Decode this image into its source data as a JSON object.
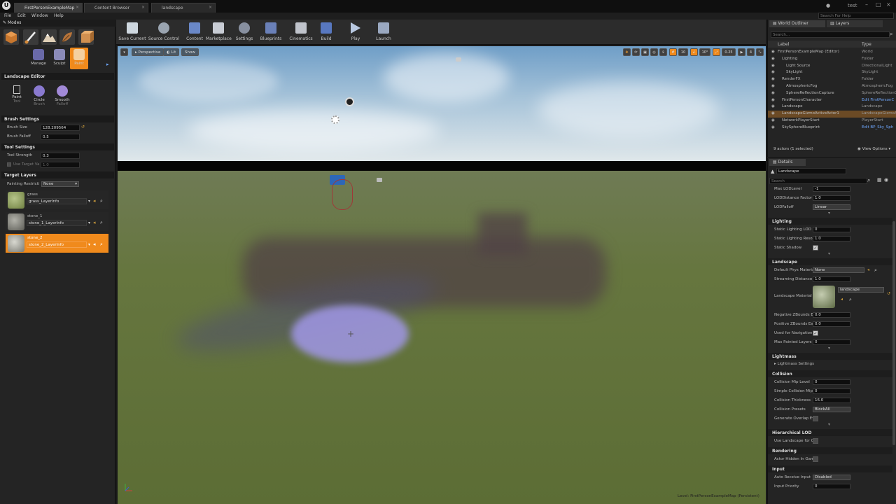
{
  "tabs": [
    "FirstPersonExampleMap",
    "Content Browser",
    "landscape"
  ],
  "menu": [
    "File",
    "Edit",
    "Window",
    "Help"
  ],
  "user": "test",
  "search_help_placeholder": "Search For Help",
  "modes": {
    "title": "Modes",
    "sub_buttons": [
      "Manage",
      "Sculpt",
      "Paint"
    ],
    "landscape_editor_title": "Landscape Editor",
    "tools": [
      {
        "label": "Paint",
        "sub": "Tool"
      },
      {
        "label": "Circle",
        "sub": "Brush"
      },
      {
        "label": "Smooth",
        "sub": "Falloff"
      }
    ],
    "brush_settings": {
      "title": "Brush Settings",
      "brush_size_label": "Brush Size",
      "brush_size_value": "128.209564",
      "brush_falloff_label": "Brush Falloff",
      "brush_falloff_value": "0.5"
    },
    "tool_settings": {
      "title": "Tool Settings",
      "tool_strength_label": "Tool Strength",
      "tool_strength_value": "0.3",
      "use_target_label": "Use Target Va",
      "use_target_value": "1.0"
    },
    "target_layers": {
      "title": "Target Layers",
      "painting_restrict_label": "Painting Restricti",
      "painting_restrict_value": "None",
      "layers": [
        {
          "name": "grass",
          "info": "grass_LayerInfo",
          "color": "#7d8c55"
        },
        {
          "name": "stone_1",
          "info": "stone_1_LayerInfo",
          "color": "#8a8a82"
        },
        {
          "name": "stone_2",
          "info": "stone_2_LayerInfo",
          "color": "#9a9a92"
        }
      ]
    }
  },
  "toolbar": [
    "Save Current",
    "Source Control",
    "Content",
    "Marketplace",
    "Settings",
    "Blueprints",
    "Cinematics",
    "Build",
    "Play",
    "Launch"
  ],
  "viewport": {
    "perspective": "Perspective",
    "lit": "Lit",
    "show": "Show",
    "snap_values": [
      "10",
      "10°",
      "0.25",
      "4"
    ],
    "level_label": "Level:  FirstPersonExampleMap (Persistent)"
  },
  "outliner": {
    "tab_world": "World Outliner",
    "tab_layers": "Layers",
    "search_placeholder": "Search...",
    "col_label": "Label",
    "col_type": "Type",
    "rows": [
      {
        "name": "FirstPersonExampleMap (Editor)",
        "type": "World",
        "indent": 0
      },
      {
        "name": "Lighting",
        "type": "Folder",
        "indent": 1
      },
      {
        "name": "Light Source",
        "type": "DirectionalLight",
        "indent": 2
      },
      {
        "name": "SkyLight",
        "type": "SkyLight",
        "indent": 2
      },
      {
        "name": "RenderFX",
        "type": "Folder",
        "indent": 1
      },
      {
        "name": "AtmosphericFog",
        "type": "AtmosphericFog",
        "indent": 2
      },
      {
        "name": "SphereReflectionCapture",
        "type": "SphereReflectionCapt",
        "indent": 2
      },
      {
        "name": "FirstPersonCharacter",
        "type": "Edit FirstPersonC",
        "indent": 1,
        "link": true
      },
      {
        "name": "Landscape",
        "type": "Landscape",
        "indent": 1
      },
      {
        "name": "LandscapeGizmoActiveActor1",
        "type": "LandscapeGizmoAc",
        "indent": 1,
        "selected": true
      },
      {
        "name": "NetworkPlayerStart",
        "type": "PlayerStart",
        "indent": 1
      },
      {
        "name": "SkySphereBlueprint",
        "type": "Edit BP_Sky_Sph",
        "indent": 1,
        "link": true
      }
    ],
    "status": "9 actors (1 selected)",
    "view_options": "View Options"
  },
  "details": {
    "tab": "Details",
    "name_value": "Landscape",
    "search_placeholder": "Search",
    "rows_top": [
      {
        "label": "Max LODLevel",
        "value": "-1"
      },
      {
        "label": "LODDistance Factor",
        "value": "1.0"
      },
      {
        "label": "LODFalloff",
        "value": "Linear",
        "combo": true
      }
    ],
    "lighting": {
      "title": "Lighting",
      "rows": [
        {
          "label": "Static Lighting LOD",
          "value": "0"
        },
        {
          "label": "Static Lighting Resol",
          "value": "1.0"
        },
        {
          "label": "Static Shadow",
          "value": "✓",
          "check": true
        }
      ]
    },
    "landscape": {
      "title": "Landscape",
      "default_phys_label": "Default Phys Materia",
      "default_phys_value": "None",
      "streaming_label": "Streaming Distance I",
      "streaming_value": "1.0",
      "material_label": "Landscape Material",
      "material_value": "landscape",
      "rows": [
        {
          "label": "Negative ZBounds Ex",
          "value": "0.0"
        },
        {
          "label": "Positive ZBounds Ex",
          "value": "0.0"
        },
        {
          "label": "Used for Navigation",
          "value": "✓",
          "check": true
        },
        {
          "label": "Max Painted Layers",
          "value": "0"
        }
      ]
    },
    "lightmass": {
      "title": "Lightmass",
      "row": "Lightmass Settings"
    },
    "collision": {
      "title": "Collision",
      "rows": [
        {
          "label": "Collision Mip Level",
          "value": "0"
        },
        {
          "label": "Simple Collision Mip",
          "value": "0"
        },
        {
          "label": "Collision Thickness",
          "value": "16.0"
        },
        {
          "label": "Collision Presets",
          "value": "BlockAll",
          "combo": true
        },
        {
          "label": "Generate Overlap Ev",
          "value": "",
          "check": true,
          "off": true
        }
      ]
    },
    "hlod": {
      "title": "Hierarchical LOD",
      "row": "Use Landscape for C"
    },
    "rendering": {
      "title": "Rendering",
      "row": "Actor Hidden In Gam"
    },
    "input": {
      "title": "Input",
      "row": "Auto Receive Input",
      "value": "Disabled",
      "row2": "Input Priority",
      "value2": "0"
    }
  }
}
